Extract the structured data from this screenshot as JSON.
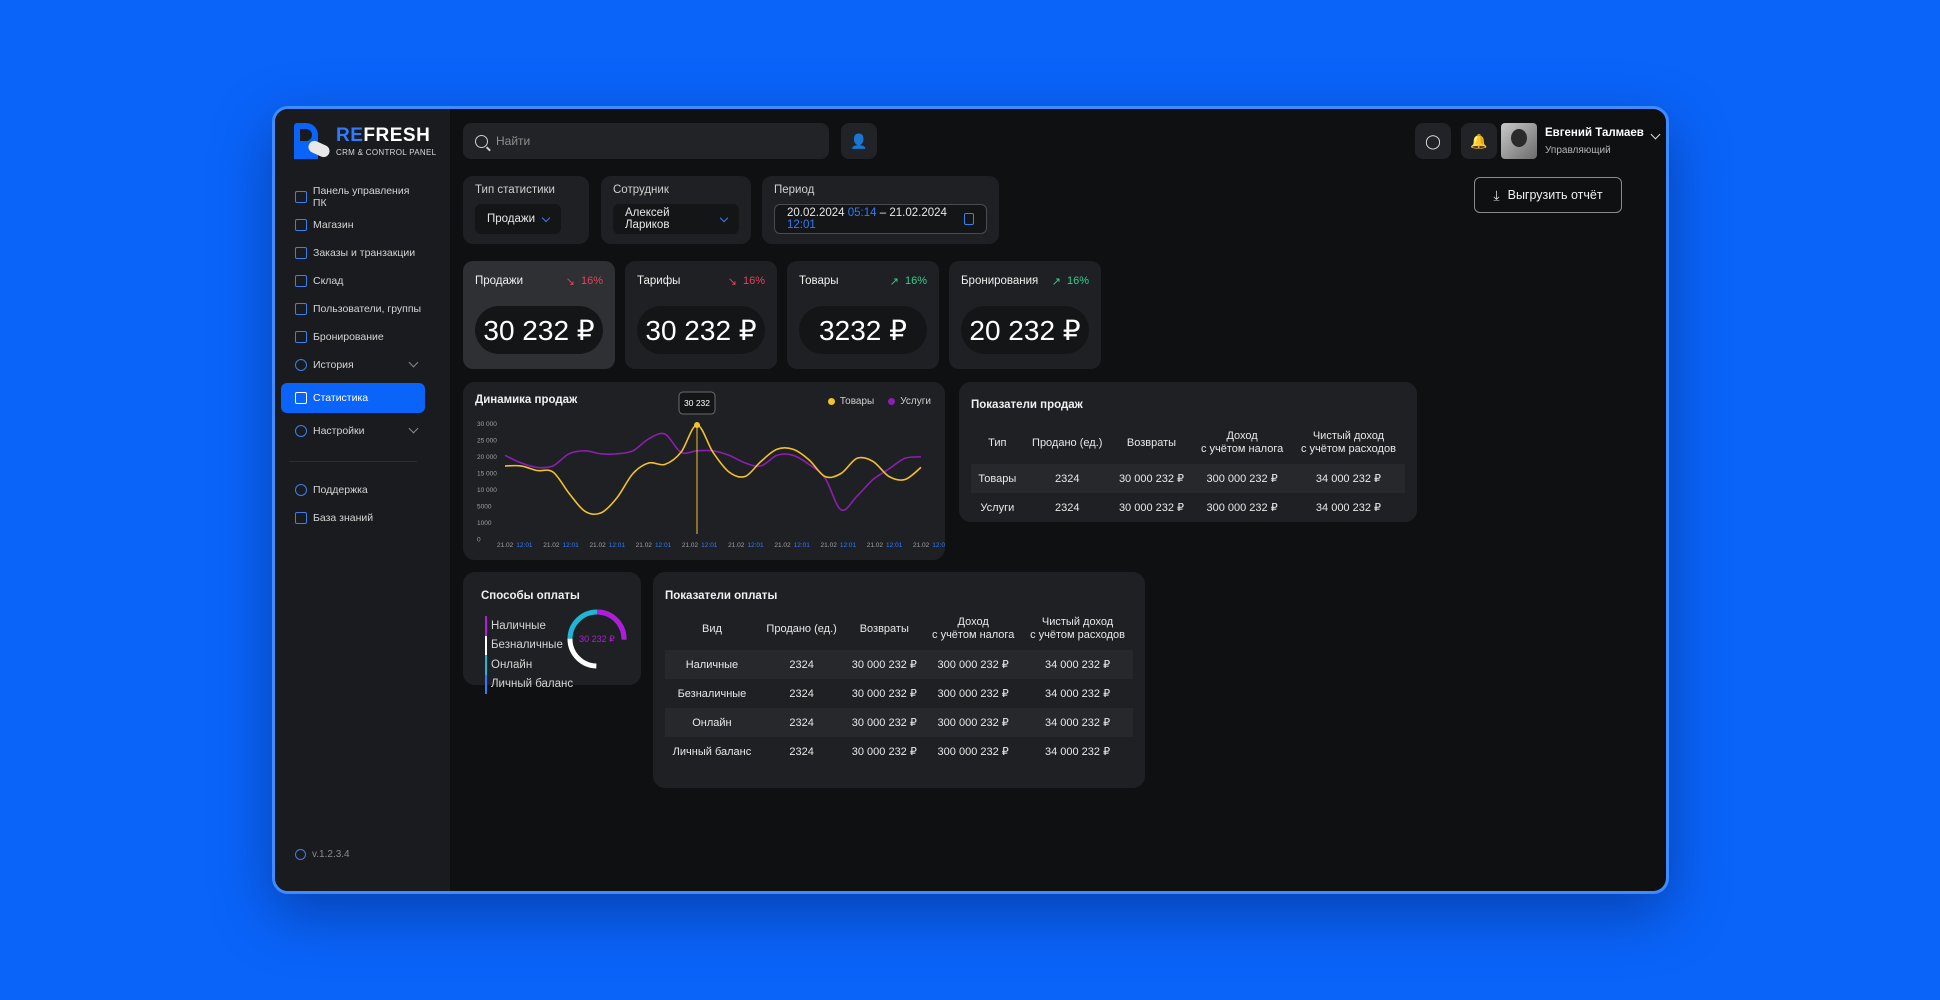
{
  "logo": {
    "brand_a": "RE",
    "brand_b": "FRESH",
    "tagline": "CRM & CONTROL PANEL"
  },
  "sidebar": {
    "items": [
      {
        "label": "Панель управления ПК"
      },
      {
        "label": "Магазин"
      },
      {
        "label": "Заказы и транзакции"
      },
      {
        "label": "Склад"
      },
      {
        "label": "Пользователи, группы"
      },
      {
        "label": "Бронирование"
      },
      {
        "label": "История"
      },
      {
        "label": "Статистика"
      },
      {
        "label": "Настройки"
      }
    ],
    "support": [
      {
        "label": "Поддержка"
      },
      {
        "label": "База знаний"
      }
    ],
    "version": "v.1.2.3.4"
  },
  "search": {
    "placeholder": "Найти"
  },
  "user": {
    "name": "Евгений Талмаев",
    "role": "Управляющий"
  },
  "filters": {
    "type_label": "Тип статистики",
    "type_value": "Продажи",
    "employee_label": "Сотрудник",
    "employee_value": "Алексей Лариков",
    "period_label": "Период",
    "date_from": "20.02.2024",
    "time_from": "05:14",
    "date_sep": "–",
    "date_to": "21.02.2024",
    "time_to": "12:01"
  },
  "export_label": "Выгрузить отчёт",
  "kpis": [
    {
      "title": "Продажи",
      "delta": "16%",
      "trend": "down",
      "value": "30 232 ₽"
    },
    {
      "title": "Тарифы",
      "delta": "16%",
      "trend": "down",
      "value": "30 232 ₽"
    },
    {
      "title": "Товары",
      "delta": "16%",
      "trend": "up",
      "value": "3232 ₽"
    },
    {
      "title": "Бронирования",
      "delta": "16%",
      "trend": "up",
      "value": "20 232 ₽"
    }
  ],
  "colors": {
    "accent": "#0a64fa",
    "goods": "#f2c12e",
    "services": "#8a1fb0",
    "down": "#e0445a",
    "up": "#2fd08a"
  },
  "chart_data": {
    "type": "line",
    "title": "Динамика продаж",
    "y_ticks": [
      "30 000",
      "25 000",
      "20 000",
      "15 000",
      "10 000",
      "5000",
      "1000",
      "0"
    ],
    "x_ticks": [
      {
        "date": "21.02",
        "time": "12:01"
      },
      {
        "date": "21.02",
        "time": "12:01"
      },
      {
        "date": "21.02",
        "time": "12:01"
      },
      {
        "date": "21.02",
        "time": "12:01"
      },
      {
        "date": "21.02",
        "time": "12:01"
      },
      {
        "date": "21.02",
        "time": "12:01"
      },
      {
        "date": "21.02",
        "time": "12:01"
      },
      {
        "date": "21.02",
        "time": "12:01"
      },
      {
        "date": "21.02",
        "time": "12:01"
      },
      {
        "date": "21.02",
        "time": "12:01"
      }
    ],
    "ylim": [
      0,
      7
    ],
    "series": [
      {
        "name": "Товары",
        "color": "#f2c12e",
        "values": [
          4.1,
          4.1,
          3.8,
          3.7,
          2.3,
          1.1,
          1.0,
          2.0,
          3.6,
          4.3,
          4.2,
          5.0,
          6.8,
          5.0,
          3.7,
          3.4,
          4.4,
          5.2,
          5.2,
          4.5,
          3.4,
          3.6,
          4.6,
          4.4,
          3.4,
          3.2,
          4.0
        ]
      },
      {
        "name": "Услуги",
        "color": "#8a1fb0",
        "values": [
          4.8,
          4.3,
          4.0,
          4.1,
          4.9,
          5.1,
          4.9,
          4.9,
          5.1,
          5.9,
          6.2,
          5.0,
          5.1,
          5.1,
          4.8,
          4.3,
          4.1,
          4.8,
          4.8,
          4.2,
          3.3,
          1.2,
          2.1,
          3.2,
          3.9,
          4.6,
          4.7
        ]
      }
    ],
    "tooltip": "30 232"
  },
  "sales_table": {
    "title": "Показатели продаж",
    "headers": [
      "Тип",
      "Продано (ед.)",
      "Возвраты",
      "Доход\nс учётом налога",
      "Чистый доход\nс учётом расходов"
    ],
    "rows": [
      [
        "Товары",
        "2324",
        "30 000 232 ₽",
        "300 000 232 ₽",
        "34 000 232 ₽"
      ],
      [
        "Услуги",
        "2324",
        "30 000 232 ₽",
        "300 000 232 ₽",
        "34 000 232 ₽"
      ]
    ]
  },
  "payment_methods": {
    "title": "Способы оплаты",
    "items": [
      {
        "label": "Наличные",
        "color": "#b21bdc"
      },
      {
        "label": "Безналичные",
        "color": "#ffffff"
      },
      {
        "label": "Онлайн",
        "color": "#1fb5d4"
      },
      {
        "label": "Личный баланс",
        "color": "#2e7bff"
      }
    ],
    "total": "30 232 ₽"
  },
  "payment_table": {
    "title": "Показатели оплаты",
    "headers": [
      "Вид",
      "Продано (ед.)",
      "Возвраты",
      "Доход\nс учётом налога",
      "Чистый доход\nс учётом расходов"
    ],
    "rows": [
      [
        "Наличные",
        "2324",
        "30 000 232 ₽",
        "300 000 232 ₽",
        "34 000 232 ₽"
      ],
      [
        "Безналичные",
        "2324",
        "30 000 232 ₽",
        "300 000 232 ₽",
        "34 000 232 ₽"
      ],
      [
        "Онлайн",
        "2324",
        "30 000 232 ₽",
        "300 000 232 ₽",
        "34 000 232 ₽"
      ],
      [
        "Личный баланс",
        "2324",
        "30 000 232 ₽",
        "300 000 232 ₽",
        "34 000 232 ₽"
      ]
    ]
  }
}
